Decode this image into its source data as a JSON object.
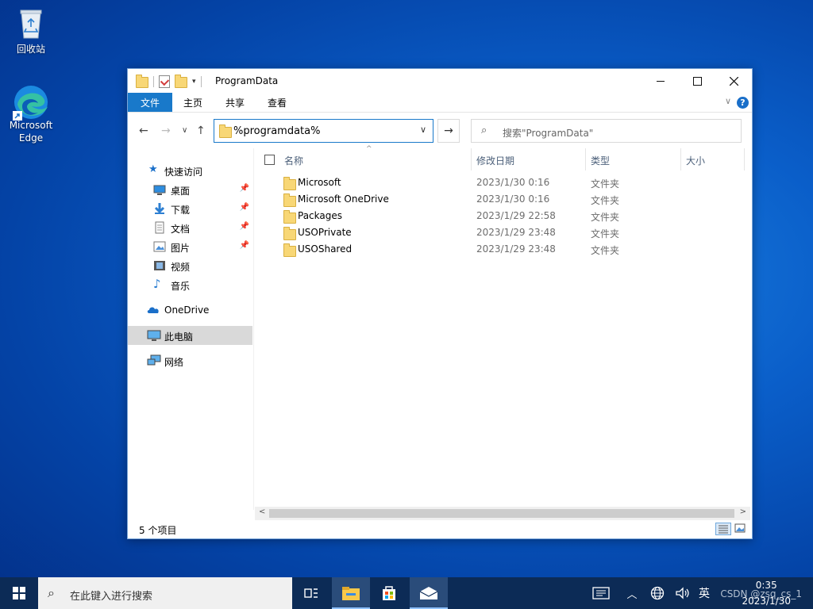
{
  "desktop": {
    "icons": [
      {
        "label": "回收站",
        "icon": "recycle-bin-icon"
      },
      {
        "label": "Microsoft Edge",
        "icon": "edge-icon"
      }
    ]
  },
  "window": {
    "title": "ProgramData",
    "ribbon_tabs": [
      "文件",
      "主页",
      "共享",
      "查看"
    ],
    "help_label": "?",
    "address": "%programdata%",
    "search_placeholder": "搜索\"ProgramData\"",
    "nav_pane": {
      "quick_access": "快速访问",
      "quick_items": [
        "桌面",
        "下载",
        "文档",
        "图片",
        "视频",
        "音乐"
      ],
      "onedrive": "OneDrive",
      "this_pc": "此电脑",
      "network": "网络"
    },
    "columns": {
      "name": "名称",
      "modified": "修改日期",
      "type": "类型",
      "size": "大小"
    },
    "files": [
      {
        "name": "Microsoft",
        "modified": "2023/1/30 0:16",
        "type": "文件夹"
      },
      {
        "name": "Microsoft OneDrive",
        "modified": "2023/1/30 0:16",
        "type": "文件夹"
      },
      {
        "name": "Packages",
        "modified": "2023/1/29 22:58",
        "type": "文件夹"
      },
      {
        "name": "USOPrivate",
        "modified": "2023/1/29 23:48",
        "type": "文件夹"
      },
      {
        "name": "USOShared",
        "modified": "2023/1/29 23:48",
        "type": "文件夹"
      }
    ],
    "status": "5 个项目"
  },
  "taskbar": {
    "search_placeholder": "在此键入进行搜索",
    "ime": "英",
    "time": "0:35",
    "date": "2023/1/30",
    "watermark": "CSDN @zsq_cs_1"
  },
  "colors": {
    "accent": "#1979ca",
    "taskbar": "#0c2b56",
    "folder": "#f8d776"
  }
}
